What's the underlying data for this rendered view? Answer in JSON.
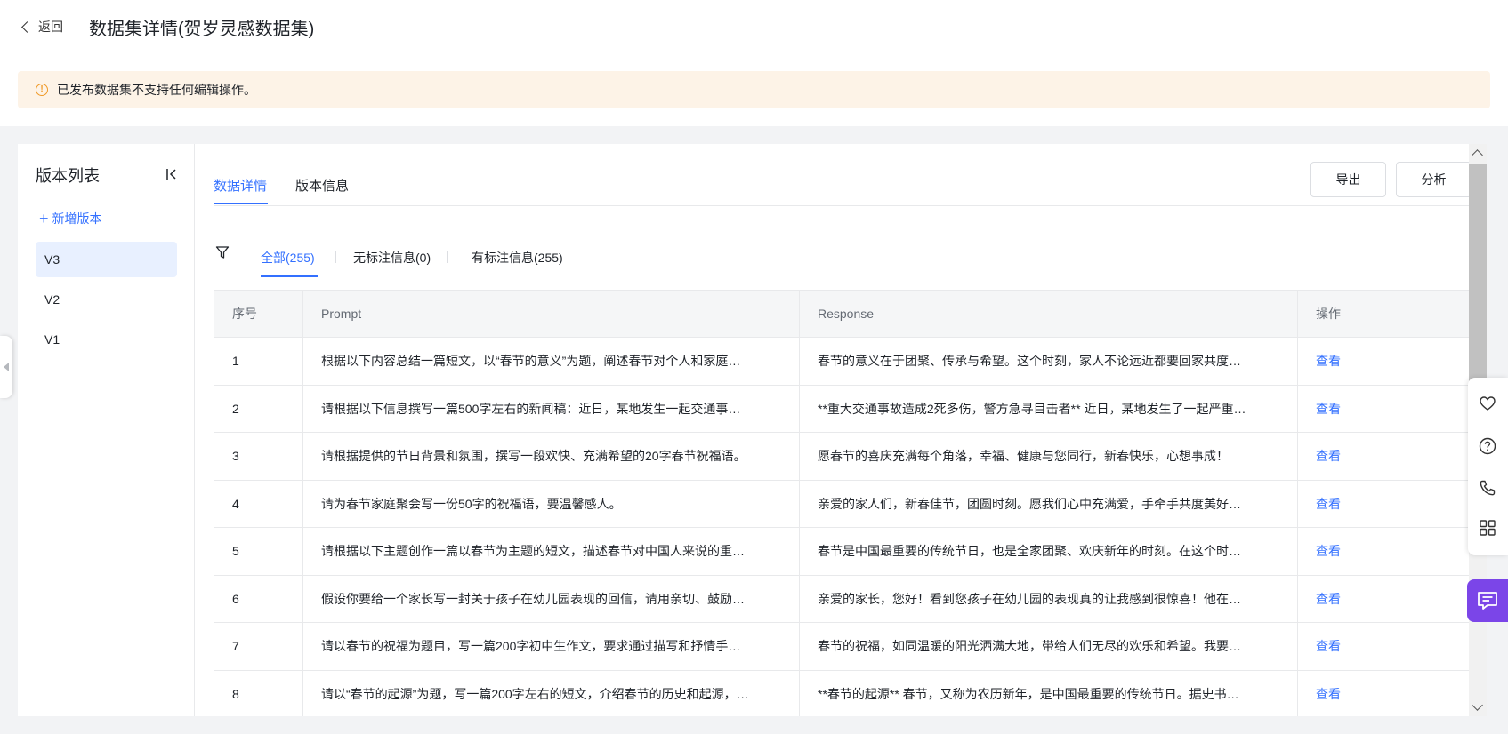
{
  "header": {
    "back_label": "返回",
    "title": "数据集详情(贺岁灵感数据集)"
  },
  "notice": {
    "icon": "warning-circle-icon",
    "text": "已发布数据集不支持任何编辑操作。"
  },
  "sidebar": {
    "title": "版本列表",
    "add_label": "新增版本",
    "versions": [
      {
        "label": "V3",
        "active": true
      },
      {
        "label": "V2",
        "active": false
      },
      {
        "label": "V1",
        "active": false
      }
    ]
  },
  "tabs": [
    {
      "label": "数据详情",
      "active": true
    },
    {
      "label": "版本信息",
      "active": false
    }
  ],
  "actions": {
    "export_label": "导出",
    "analyze_label": "分析"
  },
  "filters": [
    {
      "label": "全部(255)",
      "active": true
    },
    {
      "label": "无标注信息(0)",
      "active": false
    },
    {
      "label": "有标注信息(255)",
      "active": false
    }
  ],
  "table": {
    "columns": [
      "序号",
      "Prompt",
      "Response",
      "操作"
    ],
    "rows": [
      {
        "index": "1",
        "prompt": "根据以下内容总结一篇短文，以“春节的意义”为题，阐述春节对个人和家庭…",
        "response": "春节的意义在于团聚、传承与希望。这个时刻，家人不论远近都要回家共度…",
        "action": "查看"
      },
      {
        "index": "2",
        "prompt": "请根据以下信息撰写一篇500字左右的新闻稿：近日，某地发生一起交通事…",
        "response": "**重大交通事故造成2死多伤，警方急寻目击者** 近日，某地发生了一起严重…",
        "action": "查看"
      },
      {
        "index": "3",
        "prompt": "请根据提供的节日背景和氛围，撰写一段欢快、充满希望的20字春节祝福语。",
        "response": "愿春节的喜庆充满每个角落，幸福、健康与您同行，新春快乐，心想事成！",
        "action": "查看"
      },
      {
        "index": "4",
        "prompt": "请为春节家庭聚会写一份50字的祝福语，要温馨感人。",
        "response": "亲爱的家人们，新春佳节，团圆时刻。愿我们心中充满爱，手牵手共度美好…",
        "action": "查看"
      },
      {
        "index": "5",
        "prompt": "请根据以下主题创作一篇以春节为主题的短文，描述春节对中国人来说的重…",
        "response": "春节是中国最重要的传统节日，也是全家团聚、欢庆新年的时刻。在这个时…",
        "action": "查看"
      },
      {
        "index": "6",
        "prompt": "假设你要给一个家长写一封关于孩子在幼儿园表现的回信，请用亲切、鼓励…",
        "response": "亲爱的家长，您好！看到您孩子在幼儿园的表现真的让我感到很惊喜！他在…",
        "action": "查看"
      },
      {
        "index": "7",
        "prompt": "请以春节的祝福为题目，写一篇200字初中生作文，要求通过描写和抒情手…",
        "response": "春节的祝福，如同温暖的阳光洒满大地，带给人们无尽的欢乐和希望。我要…",
        "action": "查看"
      },
      {
        "index": "8",
        "prompt": "请以“春节的起源”为题，写一篇200字左右的短文，介绍春节的历史和起源，…",
        "response": "**春节的起源** 春节，又称为农历新年，是中国最重要的传统节日。据史书…",
        "action": "查看"
      }
    ]
  },
  "floating_tools": [
    "heart-icon",
    "help-icon",
    "phone-icon",
    "apps-grid-icon",
    "chat-icon"
  ],
  "colors": {
    "accent": "#3370ff",
    "notice_bg": "#fdf3e7",
    "warning": "#f09a28",
    "chat_button": "#7b45e8"
  }
}
